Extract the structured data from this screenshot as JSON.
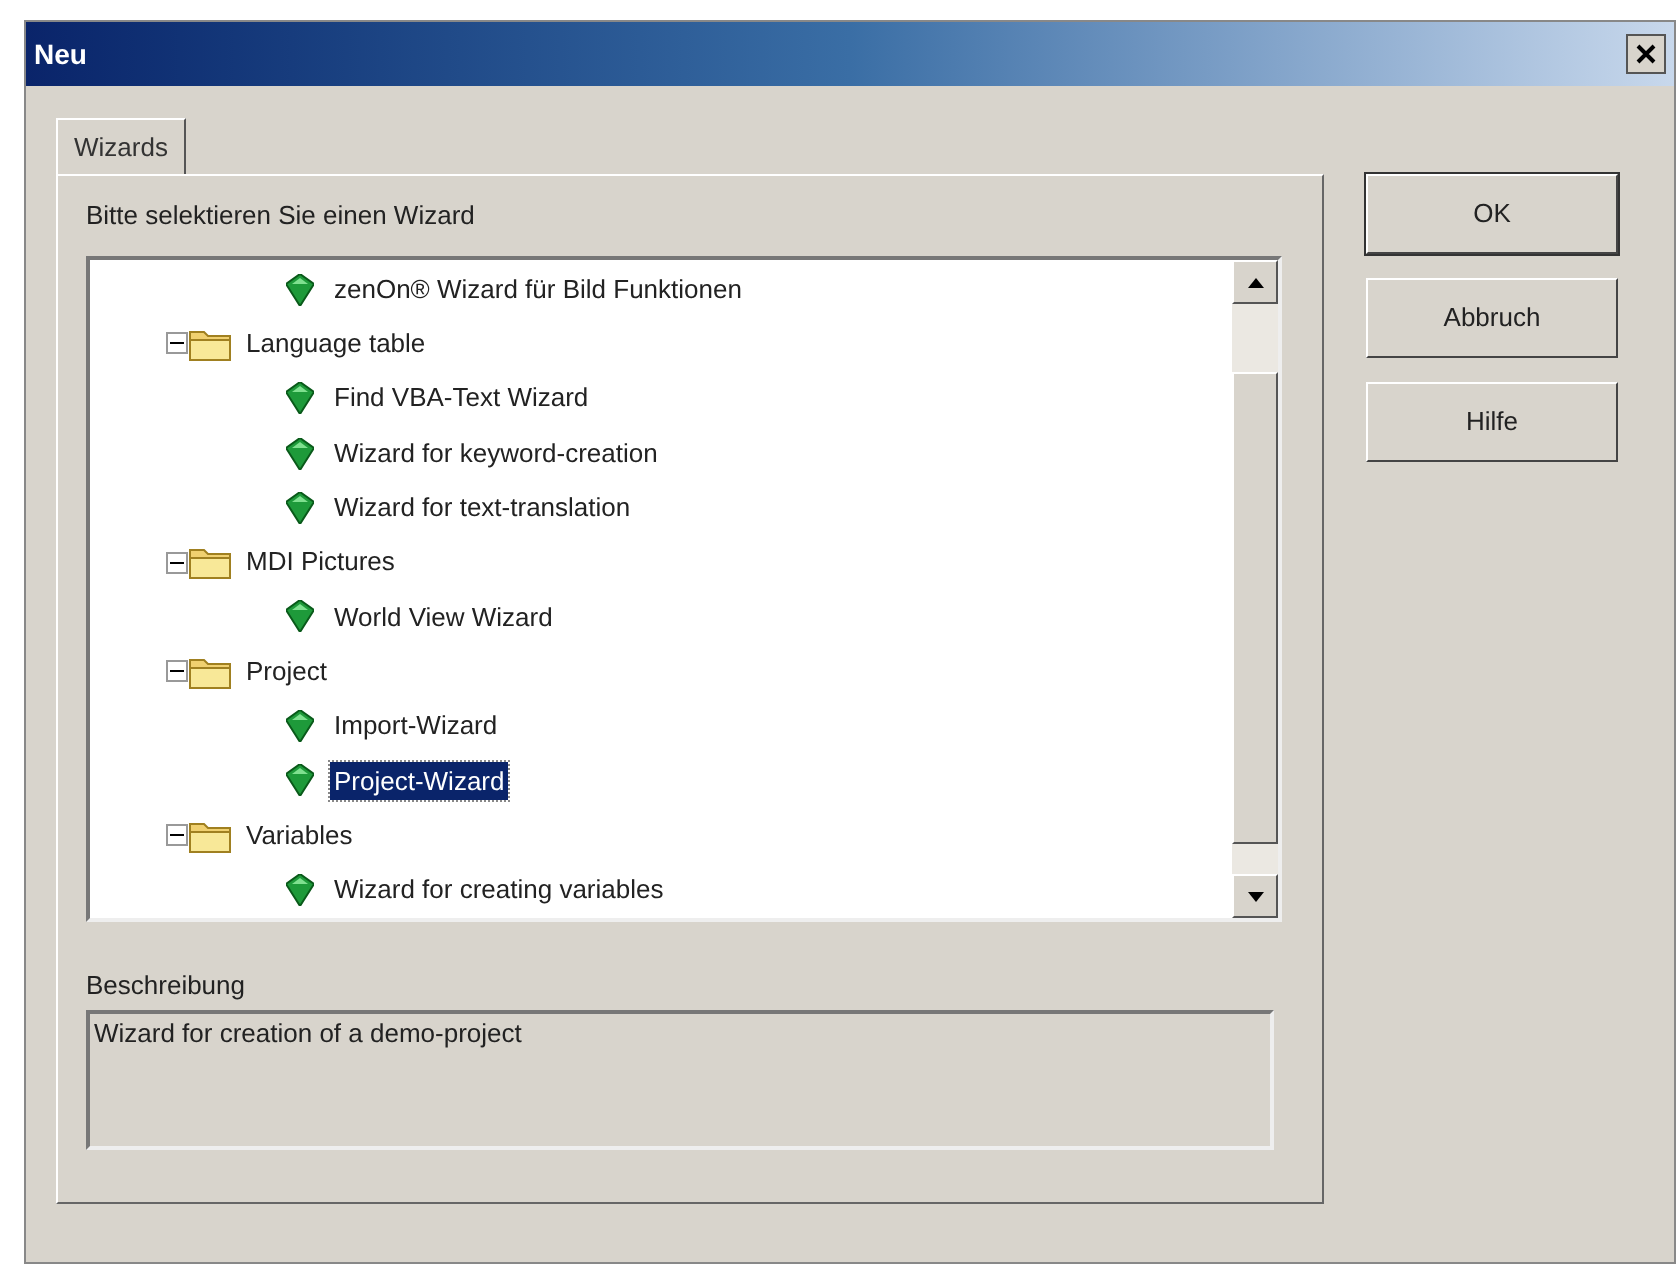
{
  "window": {
    "title": "Neu"
  },
  "tabs": [
    {
      "label": "Wizards",
      "selected": true
    }
  ],
  "prompt": "Bitte selektieren Sie einen Wizard",
  "tree": [
    {
      "kind": "wizard",
      "label": "zenOn® Wizard für Bild Funktionen",
      "selected": false
    },
    {
      "kind": "folder",
      "label": "Language table",
      "expanded": true,
      "children": [
        {
          "kind": "wizard",
          "label": "Find VBA-Text Wizard",
          "selected": false
        },
        {
          "kind": "wizard",
          "label": "Wizard for keyword-creation",
          "selected": false
        },
        {
          "kind": "wizard",
          "label": "Wizard for text-translation",
          "selected": false
        }
      ]
    },
    {
      "kind": "folder",
      "label": "MDI Pictures",
      "expanded": true,
      "children": [
        {
          "kind": "wizard",
          "label": "World View Wizard",
          "selected": false
        }
      ]
    },
    {
      "kind": "folder",
      "label": "Project",
      "expanded": true,
      "children": [
        {
          "kind": "wizard",
          "label": "Import-Wizard",
          "selected": false
        },
        {
          "kind": "wizard",
          "label": "Project-Wizard",
          "selected": true
        }
      ]
    },
    {
      "kind": "folder",
      "label": "Variables",
      "expanded": true,
      "children": [
        {
          "kind": "wizard",
          "label": "Wizard for creating variables",
          "selected": false
        }
      ]
    }
  ],
  "description": {
    "label": "Beschreibung",
    "text": "Wizard for creation of a demo-project"
  },
  "buttons": [
    "OK",
    "Abbruch",
    "Hilfe"
  ]
}
